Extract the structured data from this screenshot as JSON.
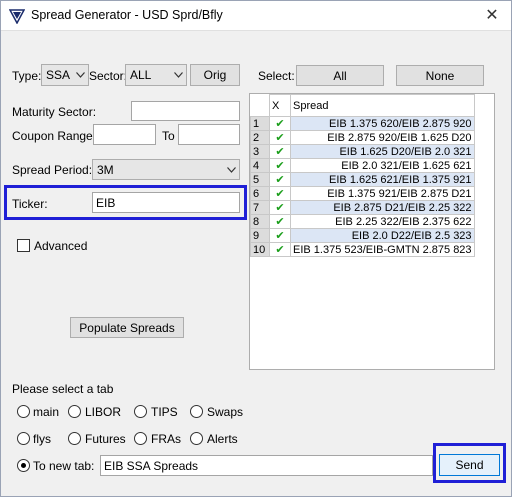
{
  "window": {
    "title": "Spread Generator - USD Sprd/Bfly",
    "close_glyph": "✕"
  },
  "filters": {
    "type_label": "Type:",
    "type_value": "SSA",
    "sector_label": "Sector:",
    "sector_value": "ALL",
    "orig_button": "Orig",
    "select_label": "Select:",
    "all_button": "All",
    "none_button": "None"
  },
  "form": {
    "maturity_label": "Maturity Sector:",
    "maturity_value": "",
    "coupon_label": "Coupon Range:",
    "coupon_to_label": "To",
    "coupon_from": "",
    "coupon_to": "",
    "period_label": "Spread Period:",
    "period_value": "3M",
    "ticker_label": "Ticker:",
    "ticker_value": "EIB",
    "advanced_label": "Advanced",
    "advanced_checked": false,
    "populate_button": "Populate Spreads"
  },
  "grid": {
    "columns": [
      "",
      "X",
      "Spread"
    ],
    "check_glyph": "✔",
    "rows": [
      {
        "num": "1",
        "checked": true,
        "spread": "EIB 1.375 620/EIB 2.875 920"
      },
      {
        "num": "2",
        "checked": true,
        "spread": "EIB 2.875 920/EIB 1.625 D20"
      },
      {
        "num": "3",
        "checked": true,
        "spread": "EIB 1.625 D20/EIB 2.0 321"
      },
      {
        "num": "4",
        "checked": true,
        "spread": "EIB 2.0 321/EIB 1.625 621"
      },
      {
        "num": "5",
        "checked": true,
        "spread": "EIB 1.625 621/EIB 1.375 921"
      },
      {
        "num": "6",
        "checked": true,
        "spread": "EIB 1.375 921/EIB 2.875 D21"
      },
      {
        "num": "7",
        "checked": true,
        "spread": "EIB 2.875 D21/EIB 2.25 322"
      },
      {
        "num": "8",
        "checked": true,
        "spread": "EIB 2.25 322/EIB 2.375 622"
      },
      {
        "num": "9",
        "checked": true,
        "spread": "EIB 2.0 D22/EIB 2.5 323"
      },
      {
        "num": "10",
        "checked": true,
        "spread": "EIB 1.375 523/EIB-GMTN 2.875 823"
      }
    ]
  },
  "tabs": {
    "prompt": "Please select a tab",
    "options": [
      "main",
      "LIBOR",
      "TIPS",
      "Swaps",
      "flys",
      "Futures",
      "FRAs",
      "Alerts"
    ],
    "new_tab_label": "To new tab:",
    "new_tab_selected": true,
    "new_tab_value": "EIB SSA Spreads",
    "send_button": "Send"
  },
  "colors": {
    "highlight": "#1f1fd6",
    "check": "#1a9e1a",
    "row_alt": "#dce6f5"
  }
}
